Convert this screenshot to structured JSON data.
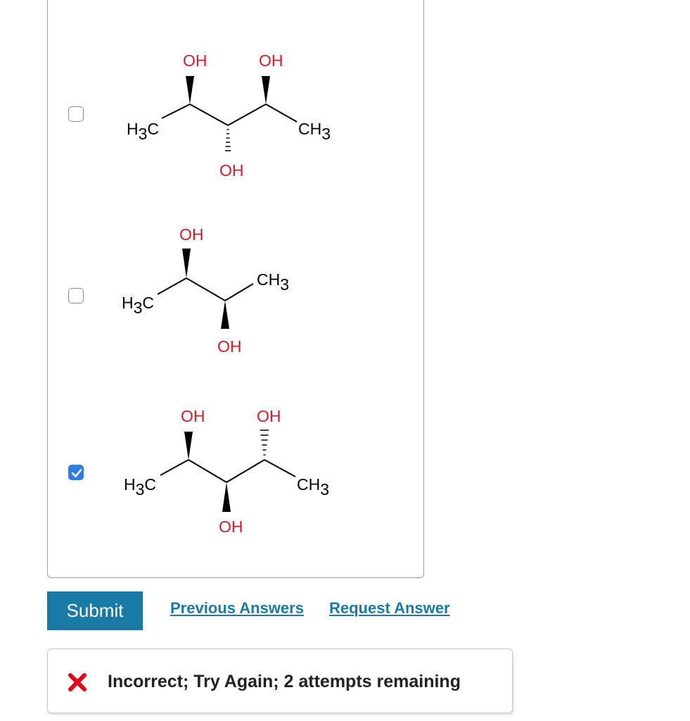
{
  "options": [
    {
      "checked": false,
      "labels": {
        "top_left": "OH",
        "top_right": "OH",
        "bottom": "OH",
        "left_group": "H",
        "left_sub": "3",
        "left_c": "C",
        "right_group": "CH",
        "right_sub": "3"
      }
    },
    {
      "checked": false,
      "labels": {
        "top": "OH",
        "bottom": "OH",
        "left_group": "H",
        "left_sub": "3",
        "left_c": "C",
        "right_group": "CH",
        "right_sub": "3"
      }
    },
    {
      "checked": true,
      "labels": {
        "top_left": "OH",
        "top_right": "OH",
        "bottom": "OH",
        "left_group": "H",
        "left_sub": "3",
        "left_c": "C",
        "right_group": "CH",
        "right_sub": "3"
      }
    }
  ],
  "actions": {
    "submit_label": "Submit",
    "previous_answers_label": "Previous Answers",
    "request_answer_label": "Request Answer"
  },
  "feedback": {
    "icon": "x-mark-icon",
    "message": "Incorrect; Try Again; 2 attempts remaining"
  },
  "colors": {
    "accent": "#1a7aa3",
    "oh_label": "#d11a2a",
    "error_icon": "#e3001b",
    "checkbox_checked": "#2f7de1"
  }
}
